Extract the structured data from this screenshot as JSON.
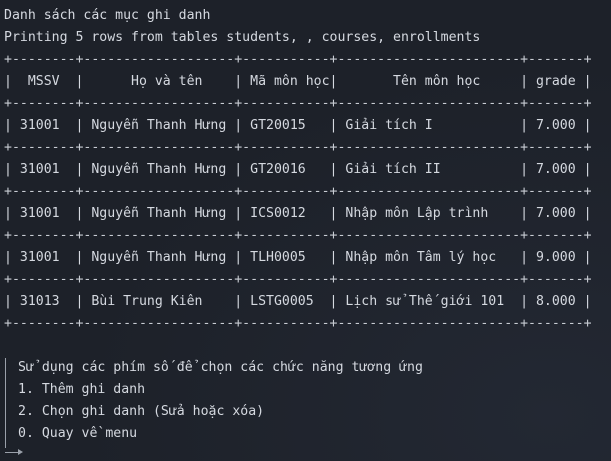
{
  "terminal": {
    "heading": "Danh sách các mục ghi danh",
    "info": "Printing 5 rows from tables students, , courses, enrollments",
    "separator": "+--------+-------------------+-----------+-----------------------+-------+",
    "header_row": "|  MSSV  |      Họ và tên    | Mã môn học|       Tên môn học     | grade |",
    "rows": [
      "| 31001  | Nguyễn Thanh Hưng | GT20015   | Giải tích I           | 7.000 |",
      "| 31001  | Nguyễn Thanh Hưng | GT20016   | Giải tích II          | 7.000 |",
      "| 31001  | Nguyễn Thanh Hưng | ICS0012   | Nhập môn Lập trình    | 7.000 |",
      "| 31001  | Nguyễn Thanh Hưng | TLH0005   | Nhập môn Tâm lý học   | 9.000 |",
      "| 31013  | Bùi Trung Kiên    | LSTG0005  | Lịch sử Thế giới 101  | 8.000 |"
    ],
    "columns": [
      "MSSV",
      "Họ và tên",
      "Mã môn học",
      "Tên môn học",
      "grade"
    ],
    "menu": {
      "prompt": "Sử dụng các phím số để chọn các chức năng tương ứng",
      "options": [
        "1. Thêm ghi danh",
        "2. Chọn ghi danh (Sửa hoặc xóa)",
        "0. Quay về menu"
      ]
    }
  }
}
